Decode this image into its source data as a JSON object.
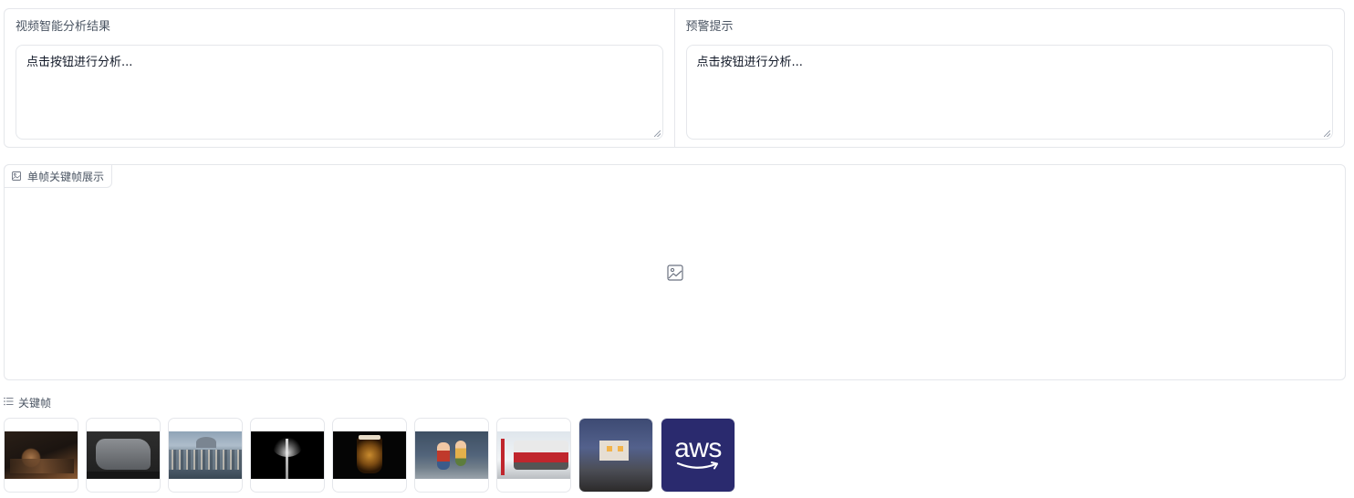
{
  "analysis": {
    "result_label": "视频智能分析结果",
    "result_text": "点击按钮进行分析...",
    "warning_label": "预警提示",
    "warning_text": "点击按钮进行分析..."
  },
  "single_frame": {
    "title": "单帧关键帧展示",
    "title_icon": "image-icon",
    "placeholder_icon": "image-icon"
  },
  "keyframes": {
    "title": "关键帧",
    "title_icon": "list-icon",
    "thumbnails": [
      {
        "id": "1",
        "description": "dark interior"
      },
      {
        "id": "2",
        "description": "map relief"
      },
      {
        "id": "3",
        "description": "city panorama"
      },
      {
        "id": "4",
        "description": "white flower on black"
      },
      {
        "id": "5",
        "description": "glass of liquor"
      },
      {
        "id": "6",
        "description": "toy figures"
      },
      {
        "id": "7",
        "description": "red tram"
      },
      {
        "id": "8",
        "description": "house at dusk"
      },
      {
        "id": "9",
        "logo_text": "aws"
      }
    ]
  },
  "colors": {
    "border": "#e5e7eb",
    "label": "#4b5563",
    "aws_bg": "#2a2a6e"
  }
}
